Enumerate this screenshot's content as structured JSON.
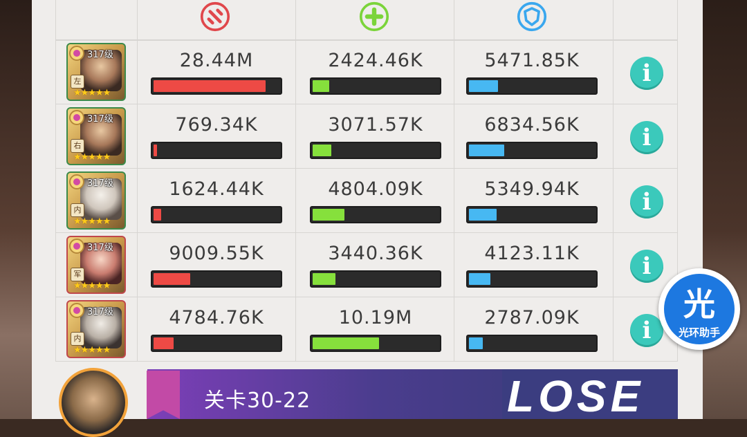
{
  "header": {
    "icons": [
      "attack-icon",
      "heal-icon",
      "shield-icon"
    ],
    "colors": {
      "attack": "#e0474b",
      "heal": "#7bd43a",
      "shield": "#3aa7ee"
    }
  },
  "rows": [
    {
      "level": "317级",
      "tag": "左",
      "damage": "28.44M",
      "damage_pct": 0.89,
      "heal": "2424.46K",
      "heal_pct": 0.13,
      "shield": "5471.85K",
      "shield_pct": 0.23
    },
    {
      "level": "317级",
      "tag": "右",
      "damage": "769.34K",
      "damage_pct": 0.03,
      "heal": "3071.57K",
      "heal_pct": 0.15,
      "shield": "6834.56K",
      "shield_pct": 0.28
    },
    {
      "level": "317级",
      "tag": "内",
      "damage": "1624.44K",
      "damage_pct": 0.06,
      "heal": "4804.09K",
      "heal_pct": 0.25,
      "shield": "5349.94K",
      "shield_pct": 0.22
    },
    {
      "level": "317级",
      "tag": "军",
      "damage": "9009.55K",
      "damage_pct": 0.29,
      "heal": "3440.36K",
      "heal_pct": 0.18,
      "shield": "4123.11K",
      "shield_pct": 0.17
    },
    {
      "level": "317级",
      "tag": "内",
      "damage": "4784.76K",
      "damage_pct": 0.16,
      "heal": "10.19M",
      "heal_pct": 0.53,
      "shield": "2787.09K",
      "shield_pct": 0.11
    }
  ],
  "footer": {
    "stage": "关卡30-22",
    "result": "LOSE"
  },
  "assistant": {
    "glyph": "光",
    "label": "光环助手"
  }
}
